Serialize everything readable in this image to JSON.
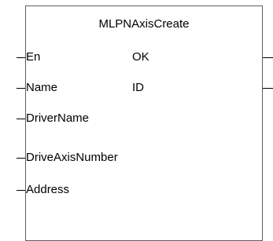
{
  "block": {
    "title": "MLPNAxisCreate",
    "inputs": [
      {
        "label": "En"
      },
      {
        "label": "Name"
      },
      {
        "label": "DriverName"
      },
      {
        "label": "DriveAxisNumber"
      },
      {
        "label": "Address"
      }
    ],
    "outputs": [
      {
        "label": "OK"
      },
      {
        "label": "ID"
      }
    ]
  },
  "colors": {
    "border": "#5e5e66",
    "text": "#000000",
    "background": "#ffffff"
  }
}
